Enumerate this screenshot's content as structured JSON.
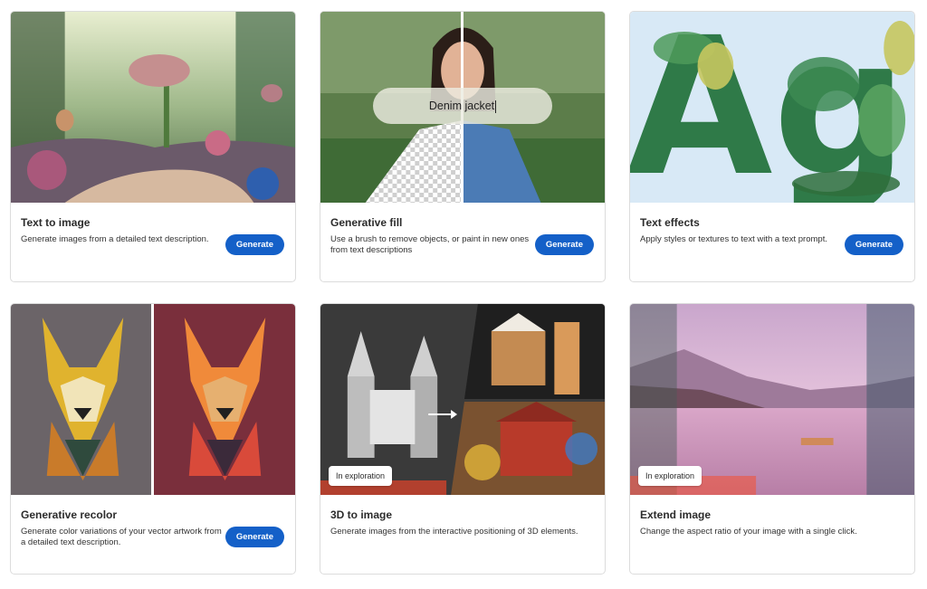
{
  "cards": [
    {
      "title": "Text to image",
      "description": "Generate images from a detailed text description.",
      "button": "Generate"
    },
    {
      "title": "Generative fill",
      "description": "Use a brush to remove objects, or paint in new ones from text descriptions",
      "button": "Generate",
      "prompt_overlay": "Denim jacket"
    },
    {
      "title": "Text effects",
      "description": "Apply styles or textures to text with a text prompt.",
      "button": "Generate",
      "art_text": "Ag"
    },
    {
      "title": "Generative recolor",
      "description": "Generate color variations of your vector artwork from a detailed text description.",
      "button": "Generate"
    },
    {
      "title": "3D to image",
      "description": "Generate images from the interactive positioning of 3D elements.",
      "badge": "In exploration"
    },
    {
      "title": "Extend image",
      "description": "Change the aspect ratio of your image with a single click.",
      "badge": "In exploration"
    }
  ],
  "colors": {
    "accent": "#1460c8",
    "card_border": "#dcdcdc"
  }
}
